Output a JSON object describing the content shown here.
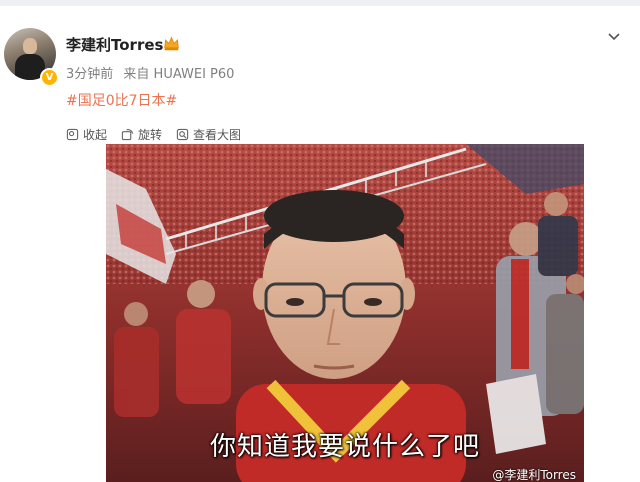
{
  "post": {
    "username": "李建利Torres",
    "time": "3分钟前",
    "source": "来自 HUAWEI P60",
    "hashtag": "#国足0比7日本#"
  },
  "actions": [
    {
      "label": "收起",
      "icon": "collapse-icon"
    },
    {
      "label": "旋转",
      "icon": "rotate-icon"
    },
    {
      "label": "查看大图",
      "icon": "zoom-icon"
    }
  ],
  "image": {
    "caption": "你知道我要说什么了吧",
    "watermark": "@李建利Torres"
  },
  "colors": {
    "hashtag": "#eb7350",
    "verified": "#ffb400"
  }
}
